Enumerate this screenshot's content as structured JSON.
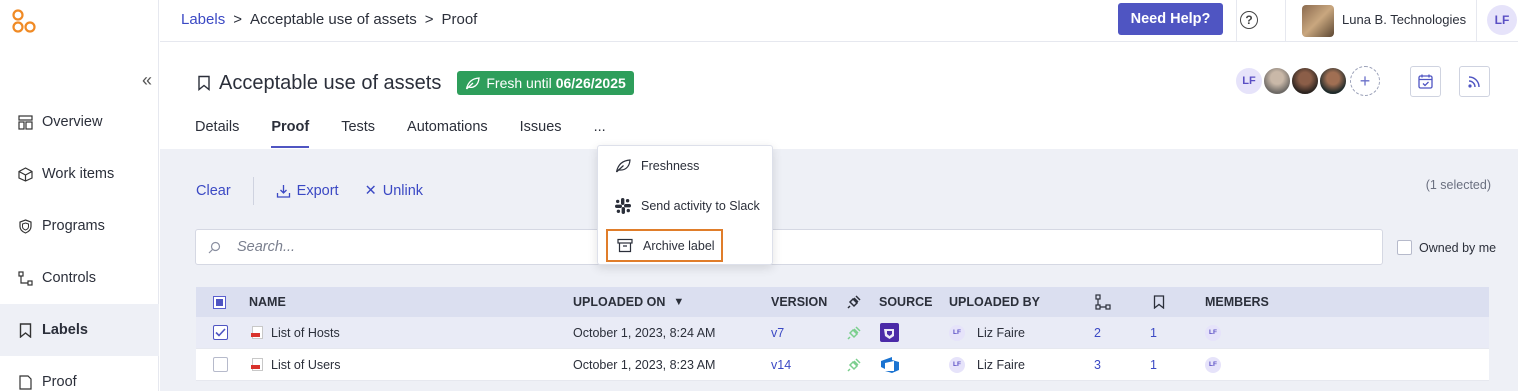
{
  "app": {
    "logo_icon": "logo-icon",
    "collapse_icon": "collapse-chevrons-icon",
    "collapse_glyph": "«"
  },
  "sidebar": {
    "items": [
      {
        "label": "Overview",
        "icon": "overview-icon",
        "active": false
      },
      {
        "label": "Work items",
        "icon": "cube-icon",
        "active": false
      },
      {
        "label": "Programs",
        "icon": "shield-icon",
        "active": false
      },
      {
        "label": "Controls",
        "icon": "controls-icon",
        "active": false
      },
      {
        "label": "Labels",
        "icon": "bookmark-icon",
        "active": true
      },
      {
        "label": "Proof",
        "icon": "proof-icon",
        "active": false
      }
    ]
  },
  "topbar": {
    "breadcrumb": [
      "Labels",
      "Acceptable use of assets",
      "Proof"
    ],
    "breadcrumb_sep": ">",
    "help_label": "Need Help?",
    "help_glyph": "?",
    "org_name": "Luna B. Technologies",
    "user_initials": "LF"
  },
  "page": {
    "title": "Acceptable use of assets",
    "fresh_label": "Fresh until",
    "fresh_date": "06/26/2025",
    "tabs": [
      {
        "label": "Details",
        "active": false
      },
      {
        "label": "Proof",
        "active": true
      },
      {
        "label": "Tests",
        "active": false
      },
      {
        "label": "Automations",
        "active": false
      },
      {
        "label": "Issues",
        "active": false
      },
      {
        "label": "...",
        "active": false
      }
    ],
    "member_initials": "LF",
    "add_member_glyph": "+"
  },
  "toolbar": {
    "clear_label": "Clear",
    "export_label": "Export",
    "unlink_label": "Unlink",
    "unlink_glyph": "✕",
    "selected_text": "(1 selected)"
  },
  "search": {
    "placeholder": "Search...",
    "value": ""
  },
  "owned_label": "Owned by me",
  "table": {
    "headers": {
      "name": "NAME",
      "uploaded_on": "UPLOADED ON",
      "version": "VERSION",
      "source": "SOURCE",
      "uploaded_by": "UPLOADED BY",
      "members": "MEMBERS"
    },
    "sort_glyph": "▼",
    "rows": [
      {
        "name": "List of Hosts",
        "uploaded_on": "October 1, 2023, 8:24 AM",
        "version": "v7",
        "source_icon": "jira-icon",
        "uploaded_by": "Liz Faire",
        "uploader_initials": "LF",
        "links": "2",
        "labels": "1",
        "member_initials": "LF",
        "selected": true
      },
      {
        "name": "List of Users",
        "uploaded_on": "October 1, 2023, 8:23 AM",
        "version": "v14",
        "source_icon": "azure-devops-icon",
        "uploaded_by": "Liz Faire",
        "uploader_initials": "LF",
        "links": "3",
        "labels": "1",
        "member_initials": "LF",
        "selected": false
      }
    ]
  },
  "menu": {
    "items": [
      {
        "label": "Freshness",
        "icon": "leaf-icon"
      },
      {
        "label": "Send activity to Slack",
        "icon": "slack-icon"
      },
      {
        "label": "Archive label",
        "icon": "archive-icon",
        "highlighted": true
      }
    ]
  },
  "colors": {
    "accent": "#4f55c2",
    "fresh_badge": "#2e9e5b",
    "highlight_outline": "#e07d2a",
    "logo": "#f08a24"
  }
}
